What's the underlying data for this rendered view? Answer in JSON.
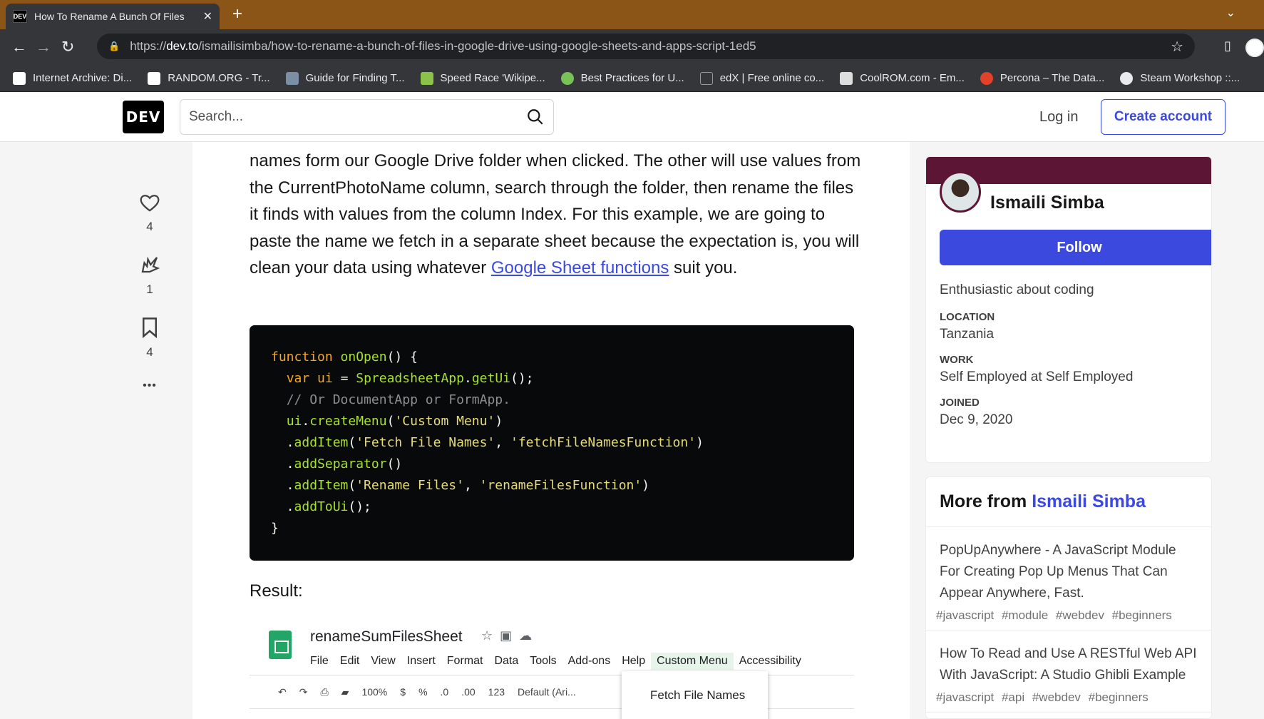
{
  "browser": {
    "tab_title": "How To Rename A Bunch Of Files",
    "tab_favicon": "DEV",
    "url_prefix": "https://",
    "url_domain": "dev.to",
    "url_path": "/ismailisimba/how-to-rename-a-bunch-of-files-in-google-drive-using-google-sheets-and-apps-script-1ed5",
    "bookmarks": [
      {
        "label": "Internet Archive: Di...",
        "color": "#ffffff"
      },
      {
        "label": "RANDOM.ORG - Tr...",
        "color": "#ffffff"
      },
      {
        "label": "Guide for Finding T...",
        "color": "#7a8fa6"
      },
      {
        "label": "Speed Race 'Wikipe...",
        "color": "#8bc34a"
      },
      {
        "label": "Best Practices for U...",
        "color": "#78c257"
      },
      {
        "label": "edX | Free online co...",
        "color": "#35363a"
      },
      {
        "label": "CoolROM.com - Em...",
        "color": "#dddddd"
      },
      {
        "label": "Percona – The Data...",
        "color": "#e4412b"
      },
      {
        "label": "Steam Workshop ::...",
        "color": "#e8eaed"
      }
    ]
  },
  "header": {
    "logo": "DEV",
    "search_placeholder": "Search...",
    "login": "Log in",
    "create_account": "Create account"
  },
  "reactions": {
    "likes": "4",
    "unicorns": "1",
    "bookmarks": "4",
    "more": "•••"
  },
  "article": {
    "para_text": "names form our Google Drive folder when clicked. The other will use values from the CurrentPhotoName column, search through the folder, then rename the files it finds with values from the column Index. For this example, we are going to paste the name we fetch in a separate sheet because the expectation is, you will clean your data using whatever ",
    "para_link": "Google Sheet functions",
    "para_end": " suit you.",
    "result_label": "Result:",
    "sheet": {
      "title": "renameSumFilesSheet",
      "menu": [
        "File",
        "Edit",
        "View",
        "Insert",
        "Format",
        "Data",
        "Tools",
        "Add-ons",
        "Help",
        "Custom Menu",
        "Accessibility"
      ],
      "toolbar_zoom": "100%",
      "toolbar_currency": "$",
      "toolbar_percent": "%",
      "toolbar_dec1": ".0",
      "toolbar_dec2": ".00",
      "toolbar_num": "123",
      "toolbar_font": "Default (Ari...",
      "dropdown_item": "Fetch File Names"
    }
  },
  "profile": {
    "name": "Ismaili Simba",
    "follow": "Follow",
    "bio": "Enthusiastic about coding",
    "location_label": "LOCATION",
    "location": "Tanzania",
    "work_label": "WORK",
    "work": "Self Employed at Self Employed",
    "joined_label": "JOINED",
    "joined": "Dec 9, 2020",
    "brand_color": "#5c1535"
  },
  "more_from": {
    "prefix": "More from",
    "author": "Ismaili Simba",
    "items": [
      {
        "title": "PopUpAnywhere - A JavaScript Module For Creating Pop Up Menus That Can Appear Anywhere, Fast.",
        "tags": "#javascript #module #webdev #beginners"
      },
      {
        "title": "How To Read and Use A RESTful Web API With JavaScript: A Studio Ghibli Example",
        "tags": "#javascript #api #webdev #beginners"
      }
    ]
  }
}
